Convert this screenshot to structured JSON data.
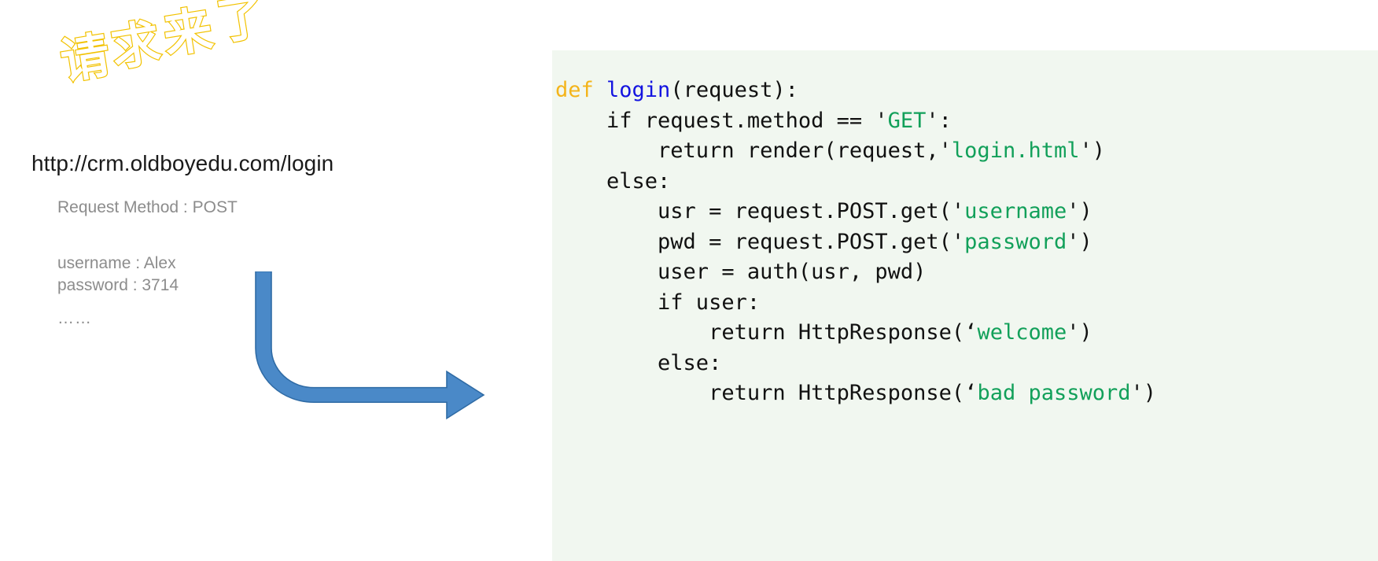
{
  "decorative_title": {
    "text": "请求来了",
    "chars": [
      "请",
      "求",
      "来",
      "了"
    ],
    "outline_color": "#f2c200",
    "fill_color": "#ffffff"
  },
  "request_info": {
    "url": "http://crm.oldboyedu.com/login",
    "method_line": "Request Method : POST",
    "username_line": "username : Alex",
    "password_line": "password : 3714",
    "ellipsis": "……"
  },
  "arrow": {
    "label": "flow-arrow",
    "fill_color": "#4a89c8",
    "stroke_color": "#2f6ba5",
    "direction": "down-then-right"
  },
  "code_panel": {
    "background_color": "#f1f7f0",
    "language": "python",
    "colors": {
      "keyword": "#f4b41a",
      "function": "#1414e0",
      "string": "#12a05a",
      "plain": "#111111"
    },
    "lines": [
      [
        {
          "t": "def ",
          "c": "kw"
        },
        {
          "t": "login",
          "c": "fn"
        },
        {
          "t": "(request):",
          "c": "pl"
        }
      ],
      [
        {
          "t": "    if request.method == '",
          "c": "pl"
        },
        {
          "t": "GET",
          "c": "str"
        },
        {
          "t": "':",
          "c": "pl"
        }
      ],
      [
        {
          "t": "        return render(request,'",
          "c": "pl"
        },
        {
          "t": "login.html",
          "c": "str"
        },
        {
          "t": "')",
          "c": "pl"
        }
      ],
      [
        {
          "t": "    else:",
          "c": "pl"
        }
      ],
      [
        {
          "t": "        usr = request.POST.get('",
          "c": "pl"
        },
        {
          "t": "username",
          "c": "str"
        },
        {
          "t": "')",
          "c": "pl"
        }
      ],
      [
        {
          "t": "        pwd = request.POST.get('",
          "c": "pl"
        },
        {
          "t": "password",
          "c": "str"
        },
        {
          "t": "')",
          "c": "pl"
        }
      ],
      [
        {
          "t": "        user = auth(usr, pwd)",
          "c": "pl"
        }
      ],
      [
        {
          "t": "        if user:",
          "c": "pl"
        }
      ],
      [
        {
          "t": "            return HttpResponse(‘",
          "c": "pl"
        },
        {
          "t": "welcome",
          "c": "str"
        },
        {
          "t": "')",
          "c": "pl"
        }
      ],
      [
        {
          "t": "        else:",
          "c": "pl"
        }
      ],
      [
        {
          "t": "            return HttpResponse(‘",
          "c": "pl"
        },
        {
          "t": "bad password",
          "c": "str"
        },
        {
          "t": "')",
          "c": "pl"
        }
      ]
    ]
  }
}
